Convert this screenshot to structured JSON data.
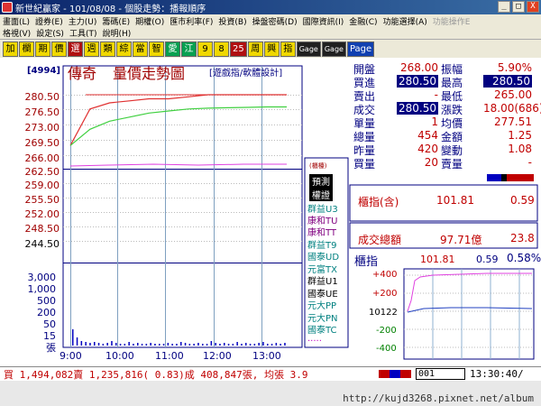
{
  "window": {
    "title": "新世紀贏家 - 101/08/08 - 個股走勢：播報順序",
    "controls": [
      "_",
      "□",
      "X"
    ]
  },
  "menu1": [
    "畫面(L)",
    "證券(E)",
    "主力(U)",
    "籌碼(E)",
    "期權(O)",
    "匯市利率(F)",
    "投資(B)",
    "操盤密碼(D)",
    "國際資訊(I)",
    "金融(C)",
    "功能選擇(A)",
    "功能操作E"
  ],
  "menu2": [
    "格視(V)",
    "設定(S)",
    "工具(T)",
    "說明(H)"
  ],
  "toolbar": [
    "加",
    "欄",
    "期",
    "價",
    "選",
    "週",
    "類",
    "綜",
    "當",
    "智",
    "愛",
    "江",
    "9",
    "8",
    "25",
    "周",
    "興",
    "指",
    "Gage",
    "Gage",
    "Page"
  ],
  "chart": {
    "stock_code": "[4994]",
    "stock_name": "傳奇",
    "title": "量價走勢圖",
    "subtitle": "[遊戲指/軟體設計]",
    "price_ticks": [
      "280.50",
      "276.50",
      "273.00",
      "269.50",
      "266.00",
      "262.50",
      "259.00",
      "255.50",
      "252.00",
      "248.50",
      "244.50"
    ],
    "volume_ticks": [
      "3,000",
      "1,000",
      "500",
      "200",
      "50",
      "15",
      "張"
    ],
    "time_ticks": [
      "9:00",
      "10:00",
      "11:00",
      "12:00",
      "13:00"
    ],
    "legend_mark": "(櫃檯)",
    "right_list": [
      "預測",
      "權證",
      "群益U3",
      "康和TU",
      "康和TT",
      "群益T9",
      "國泰UD",
      "元富TX",
      "群益U1",
      "國泰UE",
      "元大PP",
      "元大PN",
      "國泰TC",
      "....."
    ]
  },
  "chart_data": {
    "type": "line",
    "x": [
      "9:00",
      "9:10",
      "9:20",
      "9:30",
      "10:00",
      "10:30",
      "11:00",
      "11:30",
      "12:00",
      "12:30",
      "13:00",
      "13:30"
    ],
    "series": [
      {
        "values": [
          268.0,
          277.0,
          278.5,
          279.0,
          279.5,
          279.5,
          280.0,
          280.5,
          280.5,
          280.5,
          280.5,
          280.5
        ]
      },
      {
        "values": [
          268.0,
          272.0,
          274.0,
          275.0,
          276.0,
          276.5,
          277.0,
          277.2,
          277.3,
          277.4,
          277.5,
          277.51
        ]
      }
    ],
    "ylim": [
      244.5,
      280.5
    ],
    "xlabel": "",
    "ylabel": ""
  },
  "info": {
    "rows": [
      [
        "開盤",
        "268.00",
        "振幅",
        "5.90%"
      ],
      [
        "買進",
        "280.50",
        "最高",
        "280.50"
      ],
      [
        "賣出",
        "-",
        "最低",
        "265.00"
      ],
      [
        "成交",
        "280.50",
        "漲跌",
        "18.00(686)"
      ],
      [
        "單量",
        "1",
        "均價",
        "277.51"
      ],
      [
        "總量",
        "454",
        "金額",
        "1.25"
      ],
      [
        "昨量",
        "420",
        "變動",
        "1.08"
      ],
      [
        "買量",
        "20",
        "賣量",
        "-"
      ]
    ],
    "index_label": "櫃指(含)",
    "index_value": "101.81",
    "index_change": "0.59",
    "turnover_label": "成交總額",
    "turnover_value": "97.71億",
    "turnover_change": "23.8"
  },
  "mini_chart": {
    "label": "櫃指",
    "value": "101.81",
    "change": "0.59",
    "pct": "0.58%",
    "ticks": [
      "+400",
      "+200",
      "10122",
      "-200",
      "-400"
    ]
  },
  "footer": {
    "text": "買 1,494,082賣 1,235,816( 0.83)成 408,847張, 均張 3.9",
    "code": "001",
    "time": "13:30:40/"
  },
  "watermark": "http://kujd3268.pixnet.net/album",
  "colors": {
    "red": "#c00000",
    "blue": "#000080",
    "price_line": "#e03030",
    "avg_line": "#40d040",
    "index_line": "#e040e0"
  }
}
